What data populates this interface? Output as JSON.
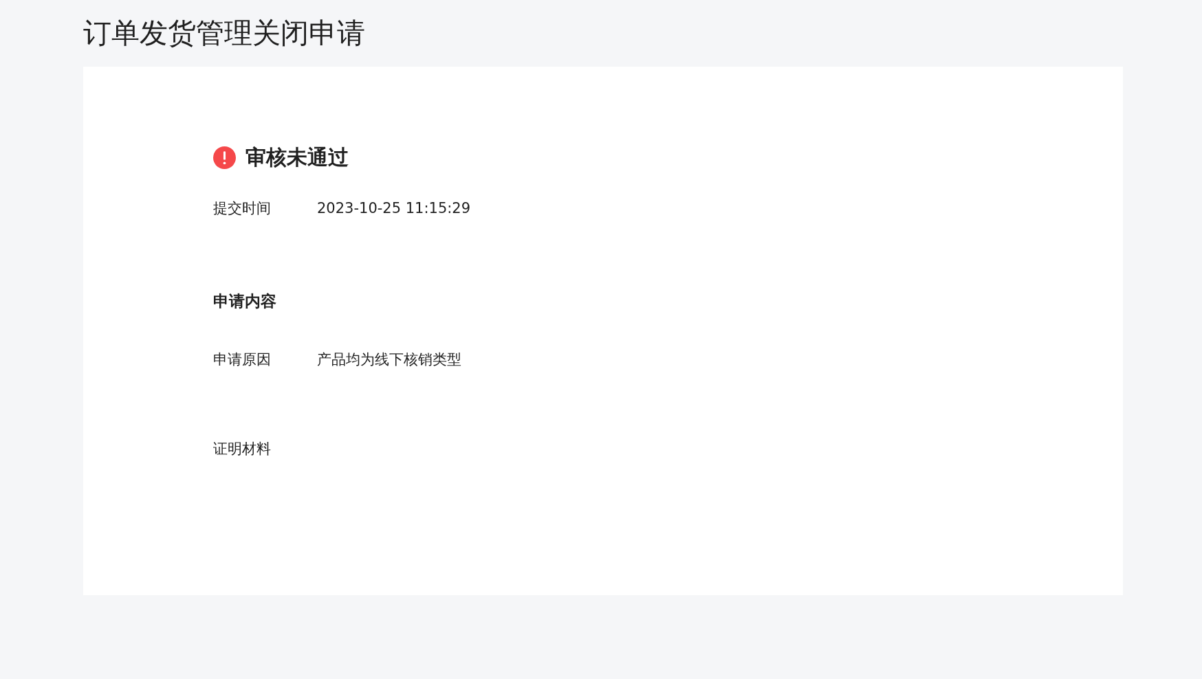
{
  "page": {
    "title": "订单发货管理关闭申请"
  },
  "status": {
    "kind": "rejected",
    "label": "审核未通过"
  },
  "submit": {
    "label": "提交时间",
    "value": "2023-10-25 11:15:29"
  },
  "section": {
    "title": "申请内容"
  },
  "fields": [
    {
      "label": "申请原因",
      "value": "产品均为线下核销类型"
    },
    {
      "label": "证明材料"
    }
  ]
}
